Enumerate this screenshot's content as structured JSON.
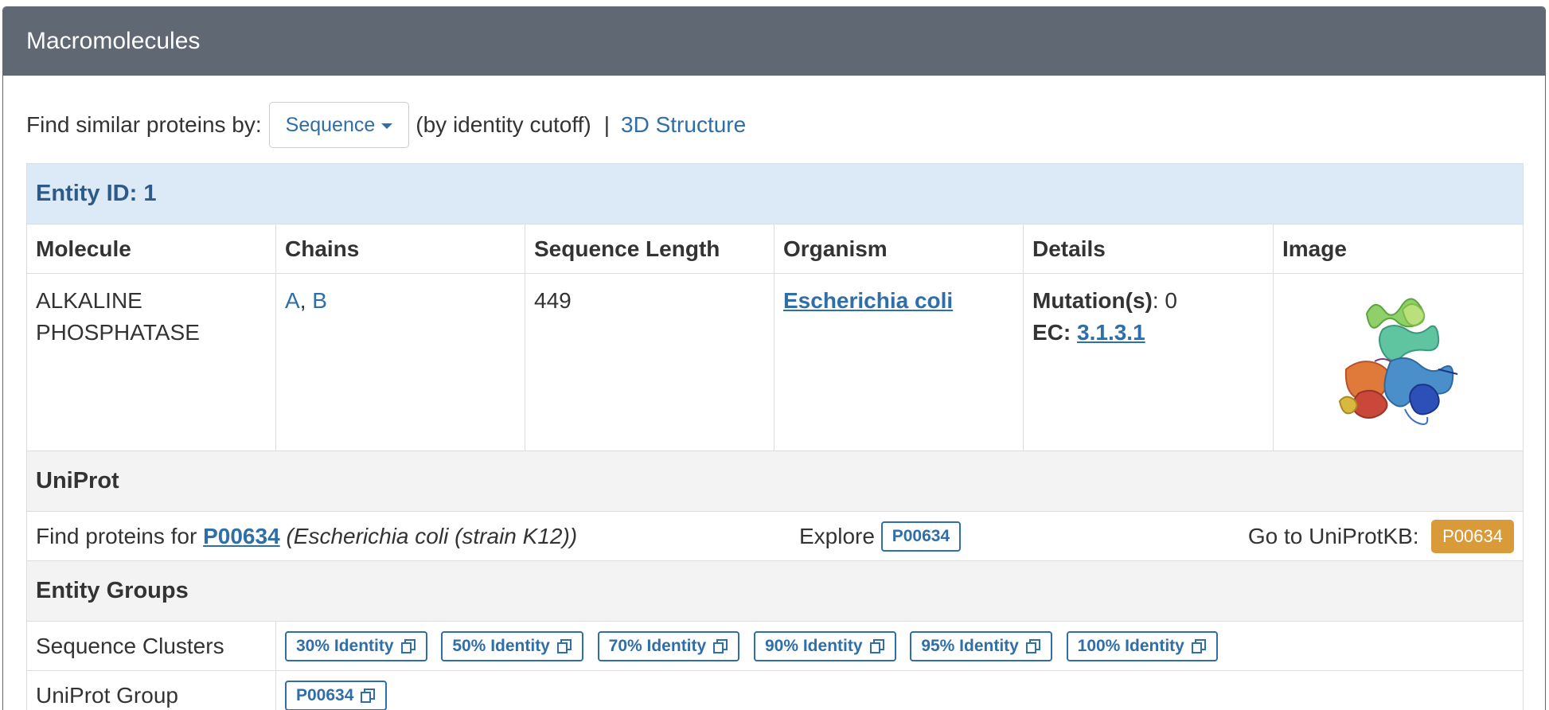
{
  "panel": {
    "title": "Macromolecules"
  },
  "find": {
    "label": "Find similar proteins by:",
    "dropdown_value": "Sequence",
    "cutoff_text": "(by identity cutoff)",
    "separator": "|",
    "structure_link": "3D Structure"
  },
  "entity": {
    "id_label": "Entity ID: 1",
    "headers": [
      "Molecule",
      "Chains",
      "Sequence Length",
      "Organism",
      "Details",
      "Image"
    ],
    "molecule_line1": "ALKALINE",
    "molecule_line2": "PHOSPHATASE",
    "chain_a": "A",
    "chain_sep": ",",
    "chain_b": "B",
    "sequence_length": "449",
    "organism": "Escherichia coli",
    "mutation_label": "Mutation(s)",
    "mutation_value": ": 0",
    "ec_label": "EC:",
    "ec_value": "3.1.3.1"
  },
  "uniprot": {
    "section_title": "UniProt",
    "find_text": "Find proteins for",
    "accession": "P00634",
    "organism_text": "(Escherichia coli (strain K12))",
    "explore_label": "Explore",
    "explore_button": "P00634",
    "goto_label": "Go to UniProtKB:",
    "goto_button": "P00634"
  },
  "groups": {
    "section_title": "Entity Groups",
    "sequence_clusters_label": "Sequence Clusters",
    "clusters": [
      "30% Identity",
      "50% Identity",
      "70% Identity",
      "90% Identity",
      "95% Identity",
      "100% Identity"
    ],
    "uniprot_group_label": "UniProt Group",
    "uniprot_group_button": "P00634"
  },
  "colors": {
    "heading_bg": "#5f6873",
    "link": "#2f6ea8",
    "entity_bg": "#dce9f6",
    "section_bg": "#f3f3f3",
    "orange_button": "#d99a3a"
  },
  "icons": [
    "caret-down-icon",
    "copy-icon"
  ]
}
